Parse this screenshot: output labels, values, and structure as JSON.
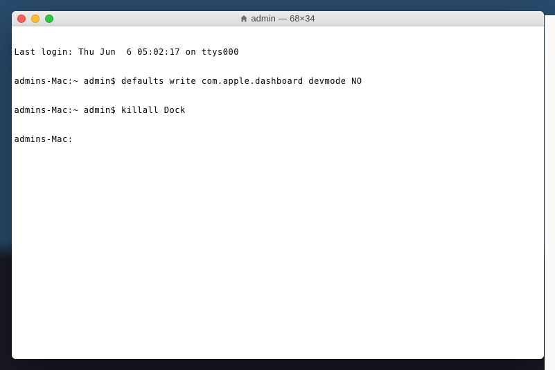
{
  "window": {
    "title": "admin — 68×34"
  },
  "terminal": {
    "lines": [
      "Last login: Thu Jun  6 05:02:17 on ttys000",
      "admins-Mac:~ admin$ defaults write com.apple.dashboard devmode NO",
      "admins-Mac:~ admin$ killall Dock",
      "admins-Mac:"
    ]
  }
}
